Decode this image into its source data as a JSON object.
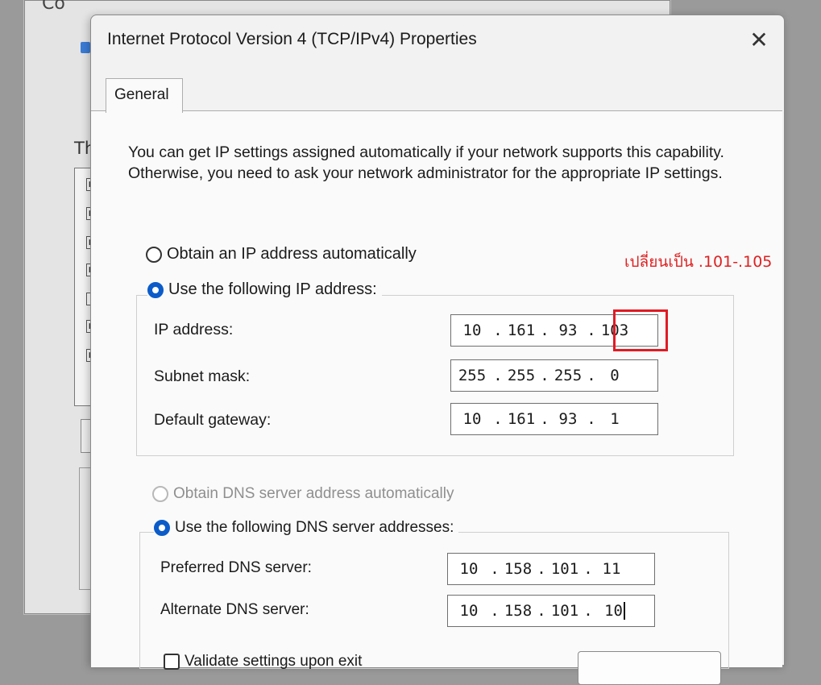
{
  "dialog": {
    "title": "Internet Protocol Version 4 (TCP/IPv4) Properties",
    "close_label": "✕",
    "tab_general": "General",
    "description": "You can get IP settings assigned automatically if your network supports this capability. Otherwise, you need to ask your network administrator for the appropriate IP settings."
  },
  "ip_section": {
    "obtain_auto_label": "Obtain an IP address automatically",
    "use_following_label": "Use the following IP address:",
    "selected": "use_following",
    "ip_address_label": "IP address:",
    "ip_address": [
      "10",
      "161",
      "93",
      "103"
    ],
    "subnet_mask_label": "Subnet mask:",
    "subnet_mask": [
      "255",
      "255",
      "255",
      "0"
    ],
    "default_gateway_label": "Default gateway:",
    "default_gateway": [
      "10",
      "161",
      "93",
      "1"
    ]
  },
  "dns_section": {
    "obtain_auto_label": "Obtain DNS server address automatically",
    "use_following_label": "Use the following DNS server addresses:",
    "selected": "use_following",
    "preferred_label": "Preferred DNS server:",
    "preferred": [
      "10",
      "158",
      "101",
      "11"
    ],
    "alternate_label": "Alternate DNS server:",
    "alternate": [
      "10",
      "158",
      "101",
      "10"
    ]
  },
  "footer": {
    "validate_label": "Validate settings upon exit"
  },
  "annotation": {
    "text": "เปลี่ยนเป็น .101-.105",
    "color": "#e01b24"
  },
  "background_window": {
    "partial_title": "Co",
    "partial_text": "Th"
  },
  "colors": {
    "accent": "#0b5cc9",
    "dialog_bg": "#f2f2f2",
    "panel_bg": "#fafafa"
  }
}
